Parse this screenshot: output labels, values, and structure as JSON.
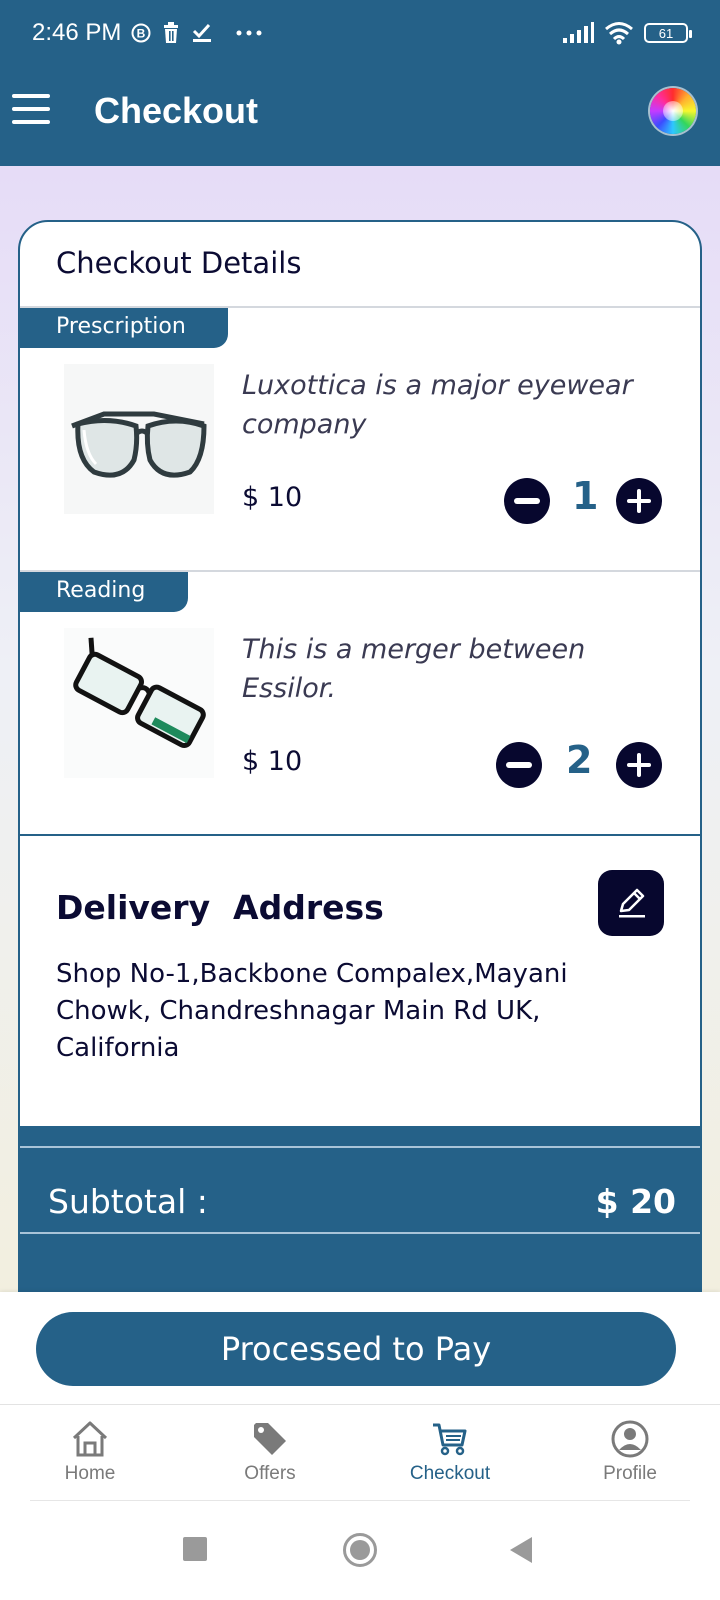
{
  "status_bar": {
    "time": "2:46 PM",
    "battery": "61",
    "icons": [
      "b-circle-icon",
      "trash-icon",
      "check-icon",
      "more-dots-icon",
      "signal-icon",
      "wifi-icon",
      "battery-icon"
    ]
  },
  "app_bar": {
    "title": "Checkout",
    "menu_icon": "hamburger-menu-icon",
    "theme_icon": "color-wheel-icon"
  },
  "checkout": {
    "title": "Checkout Details",
    "items": [
      {
        "tag": "Prescription",
        "description": "Luxottica is a major eyewear company",
        "price": "$ 10",
        "quantity": "1"
      },
      {
        "tag": "Reading",
        "description": "This is a merger between Essilor.",
        "price": "$ 10",
        "quantity": "2"
      }
    ]
  },
  "delivery": {
    "title": "Delivery  Address",
    "address": "Shop No-1,Backbone Compalex,Mayani Chowk, Chandreshnagar Main Rd UK, California",
    "edit_icon": "pencil-icon"
  },
  "summary": {
    "subtotal_label": "Subtotal :",
    "subtotal_value": "$ 20"
  },
  "pay_button": "Processed to Pay",
  "bottom_nav": [
    {
      "label": "Home",
      "icon": "home-icon",
      "active": false
    },
    {
      "label": "Offers",
      "icon": "tag-icon",
      "active": false
    },
    {
      "label": "Checkout",
      "icon": "cart-icon",
      "active": true
    },
    {
      "label": "Profile",
      "icon": "profile-icon",
      "active": false
    }
  ],
  "colors": {
    "primary": "#256188",
    "dark": "#07072e",
    "text": "#0b0b33"
  }
}
